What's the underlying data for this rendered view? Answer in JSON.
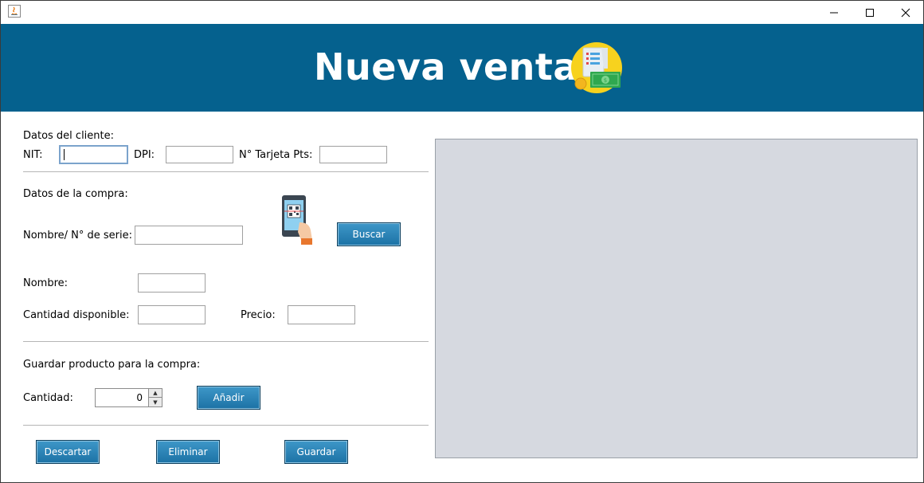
{
  "window": {
    "minimize_label": "—",
    "maximize_label": "☐",
    "close_label": "✕"
  },
  "header": {
    "title": "Nueva venta",
    "background": "#05618e"
  },
  "cliente": {
    "section_label": "Datos del cliente:",
    "nit_label": "NIT:",
    "nit_value": "",
    "dpi_label": "DPI:",
    "dpi_value": "",
    "tarjeta_label": "N° Tarjeta Pts:",
    "tarjeta_value": ""
  },
  "compra": {
    "section_label": "Datos de la compra:",
    "nombre_serie_label": "Nombre/ N° de serie:",
    "nombre_serie_value": "",
    "buscar_button": "Buscar",
    "nombre_label": "Nombre:",
    "nombre_value": "",
    "cantidad_disp_label": "Cantidad disponible:",
    "cantidad_disp_value": "",
    "precio_label": "Precio:",
    "precio_value": ""
  },
  "guardar_producto": {
    "section_label": "Guardar producto para la compra:",
    "cantidad_label": "Cantidad:",
    "cantidad_value": "0",
    "anadir_button": "Añadir"
  },
  "actions": {
    "descartar": "Descartar",
    "eliminar": "Eliminar",
    "guardar": "Guardar"
  },
  "accent_color": "#1c72a5"
}
